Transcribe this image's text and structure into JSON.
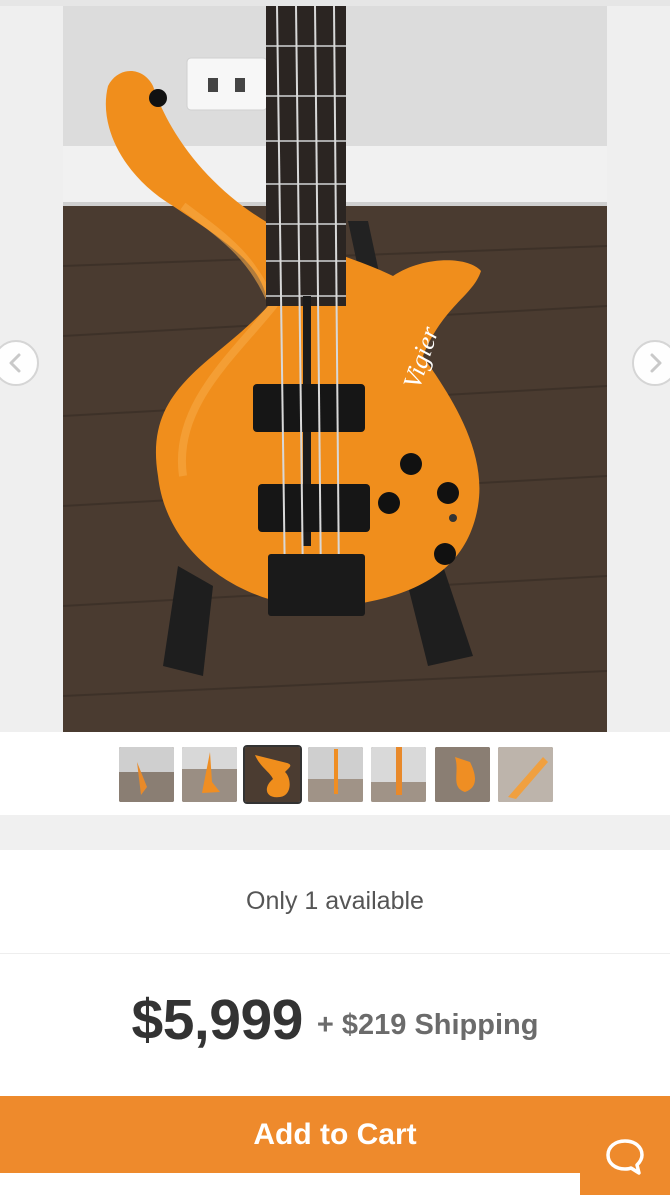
{
  "gallery": {
    "main_image_alt": "Orange Vigier bass guitar on stand",
    "logo_text": "Vigier",
    "thumbnail_count": 7,
    "active_thumbnail": 3
  },
  "listing": {
    "availability": "Only 1 available",
    "price": "$5,999",
    "shipping": "+ $219 Shipping",
    "add_to_cart": "Add to Cart"
  },
  "colors": {
    "accent": "#ee8a2c",
    "price_text": "#333333",
    "shipping_text": "#6b6b6b"
  },
  "icons": {
    "prev": "chevron-left-icon",
    "next": "chevron-right-icon",
    "chat": "chat-bubble-icon"
  }
}
